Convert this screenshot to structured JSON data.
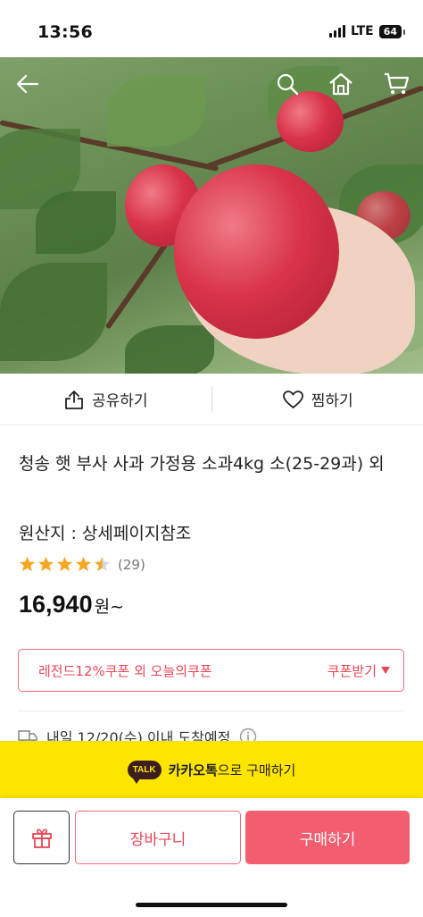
{
  "status": {
    "time": "13:56",
    "network": "LTE",
    "battery": "64"
  },
  "hero": {
    "image_alt": "apples on tree held by hand",
    "back_icon": "back-arrow-icon",
    "search_icon": "search-icon",
    "home_icon": "home-icon",
    "cart_icon": "cart-icon"
  },
  "actions": {
    "share_label": "공유하기",
    "wish_label": "찜하기"
  },
  "product": {
    "title": "청송 햇 부사 사과 가정용 소과4kg 소(25-29과) 외",
    "origin": "원산지 : 상세페이지참조",
    "rating": 4.5,
    "review_count": "(29)",
    "price": "16,940",
    "price_unit": "원~"
  },
  "coupon": {
    "text": "레전드12%쿠폰 외 오늘의쿠폰",
    "get_label": "쿠폰받기",
    "color": "#e8475a"
  },
  "delivery": {
    "text": "내일 12/20(수) 이내 도착예정"
  },
  "kakao": {
    "badge": "TALK",
    "brand": "카카오톡",
    "text": "으로 구매하기",
    "color": "#fee500"
  },
  "bottom": {
    "cart_label": "장바구니",
    "buy_label": "구매하기",
    "accent": "#f25e6f"
  }
}
